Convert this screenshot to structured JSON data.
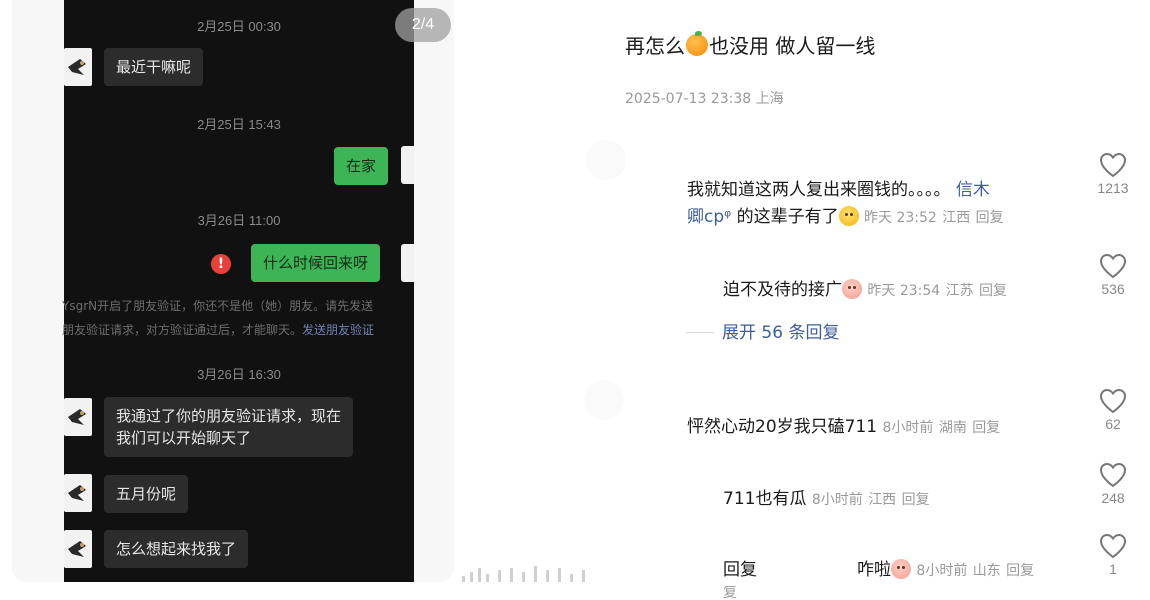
{
  "image_viewer": {
    "page_indicator": "2/4",
    "chat": {
      "messages": [
        {
          "time": "2月25日 00:30"
        },
        {
          "from": "them",
          "text": "最近干嘛呢"
        },
        {
          "time": "2月25日 15:43"
        },
        {
          "from": "me",
          "text": "在家"
        },
        {
          "time": "3月26日 11:00"
        },
        {
          "from": "me",
          "text": "什么时候回来呀",
          "failed": true,
          "alert": "!"
        },
        {
          "system_line1": "YsgrN开启了朋友验证，你还不是他（她）朋友。请先发送",
          "system_line2": "朋友验证请求，对方验证通过后，才能聊天。",
          "system_link": "发送朋友验证"
        },
        {
          "time": "3月26日 16:30"
        },
        {
          "from": "them",
          "text_line1": "我通过了你的朋友验证请求，现在",
          "text_line2": "我们可以开始聊天了"
        },
        {
          "from": "them",
          "text": "五月份呢"
        },
        {
          "from": "them",
          "text": "怎么想起来找我了"
        }
      ]
    }
  },
  "post": {
    "title_before": "再怎么",
    "title_emoji": "orange",
    "title_after": "也没用 做人留一线",
    "meta": "2025-07-13 23:38 上海"
  },
  "comments": [
    {
      "line1": "我就知道这两人复出来圈钱的。。。。",
      "mention_part1": "信木",
      "mention_part2": "卿cpᵠ",
      "line2_text": "的这辈子有了",
      "emoji": "yellow",
      "time": "昨天 23:52",
      "location": "江西",
      "reply": "回复",
      "likes": "1213"
    },
    {
      "text": "迫不及待的接广",
      "emoji": "pink",
      "time": "昨天 23:54",
      "location": "江苏",
      "reply": "回复",
      "likes": "536"
    },
    {
      "expand": "展开 56 条回复"
    },
    {
      "text": "怦然心动20岁我只磕711",
      "time": "8小时前",
      "location": "湖南",
      "reply": "回复",
      "likes": "62"
    },
    {
      "text": "711也有瓜",
      "time": "8小时前",
      "location": "江西",
      "reply": "回复",
      "likes": "248"
    },
    {
      "text_a": "回复",
      "text_b": "咋啦",
      "emoji": "pink",
      "time": "8小时前",
      "location": "山东",
      "reply": "回复",
      "reply_wrap": "复",
      "likes": "1"
    }
  ],
  "colors": {
    "mention": "#3f5e99",
    "meta_gray": "#9a9a9a",
    "chat_out": "#3db456",
    "chat_in": "#2c2c2c",
    "alert": "#e8413a"
  }
}
